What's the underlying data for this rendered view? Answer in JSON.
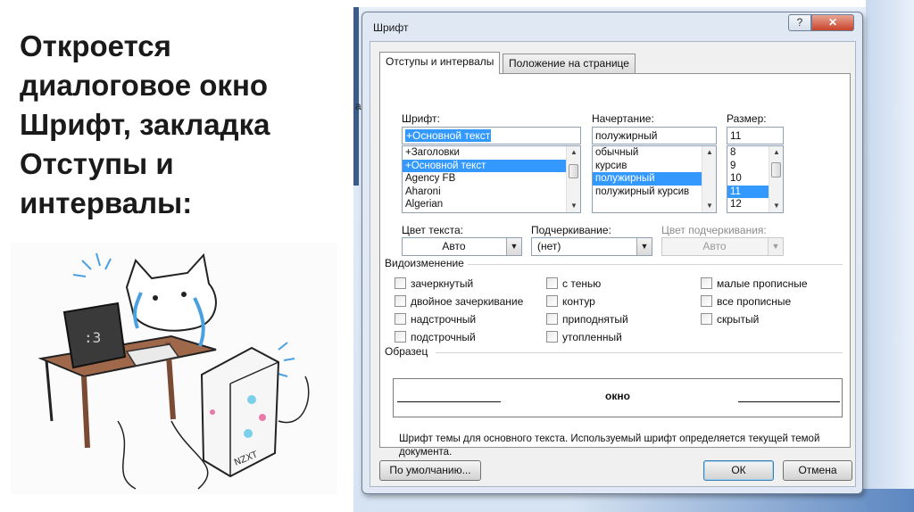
{
  "slide": {
    "lines": [
      "Откроется",
      "диалоговое окно",
      "Шрифт, закладка",
      "Отступы и",
      "интервалы:"
    ],
    "side_glyph": "а",
    "illustration": "cat-at-computer-drawing",
    "illustration_text": "NZXT"
  },
  "dialog": {
    "title": "Шрифт",
    "help": "?",
    "close": "✕",
    "tabs": [
      "Отступы и интервалы",
      "Положение на странице"
    ],
    "font_label": "Шрифт:",
    "font_value": "+Основной текст",
    "font_list": [
      "+Заголовки",
      "+Основной текст",
      "Agency FB",
      "Aharoni",
      "Algerian"
    ],
    "font_selected_index": 1,
    "style_label": "Начертание:",
    "style_value": "полужирный",
    "style_list": [
      "обычный",
      "курсив",
      "полужирный",
      "полужирный курсив"
    ],
    "style_selected_index": 2,
    "size_label": "Размер:",
    "size_value": "11",
    "size_list": [
      "8",
      "9",
      "10",
      "11",
      "12"
    ],
    "size_selected_index": 3,
    "color_label": "Цвет текста:",
    "color_value": "Авто",
    "underline_label": "Подчеркивание:",
    "underline_value": "(нет)",
    "underline_color_label": "Цвет подчеркивания:",
    "underline_color_value": "Авто",
    "effects_title": "Видоизменение",
    "effects": [
      [
        "зачеркнутый",
        "двойное зачеркивание",
        "надстрочный",
        "подстрочный"
      ],
      [
        "с тенью",
        "контур",
        "приподнятый",
        "утопленный"
      ],
      [
        "малые прописные",
        "все прописные",
        "скрытый"
      ]
    ],
    "sample_title": "Образец",
    "sample_text": "окно",
    "note": "Шрифт темы для основного текста. Используемый шрифт определяется текущей темой документа.",
    "default_button": "По умолчанию...",
    "ok_button": "ОК",
    "cancel_button": "Отмена"
  }
}
